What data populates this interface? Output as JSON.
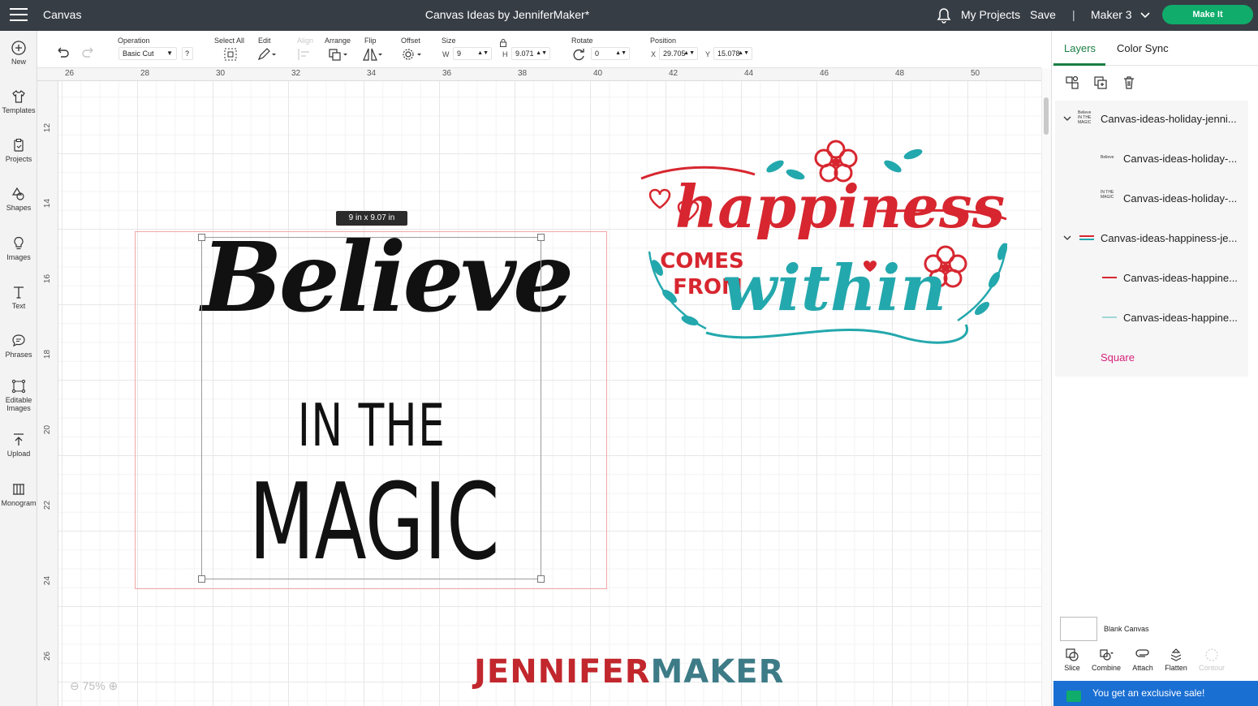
{
  "topbar": {
    "app_title": "Canvas",
    "doc_title": "Canvas Ideas by JenniferMaker*",
    "my_projects": "My Projects",
    "save": "Save",
    "divider": "|",
    "machine": "Maker 3",
    "make_it": "Make It"
  },
  "sidebar": {
    "items": [
      {
        "label": "New",
        "icon": "plus-circle-icon"
      },
      {
        "label": "Templates",
        "icon": "shirt-icon"
      },
      {
        "label": "Projects",
        "icon": "projects-icon"
      },
      {
        "label": "Shapes",
        "icon": "shapes-icon"
      },
      {
        "label": "Images",
        "icon": "lightbulb-icon"
      },
      {
        "label": "Text",
        "icon": "text-icon"
      },
      {
        "label": "Phrases",
        "icon": "speech-bubble-icon"
      },
      {
        "label": "Editable Images",
        "icon": "editable-images-icon"
      },
      {
        "label": "Upload",
        "icon": "upload-icon"
      },
      {
        "label": "Monogram",
        "icon": "monogram-icon"
      }
    ]
  },
  "toolbar": {
    "operation_label": "Operation",
    "operation_value": "Basic Cut",
    "help": "?",
    "select_all_label": "Select All",
    "edit_label": "Edit",
    "align_label": "Align",
    "arrange_label": "Arrange",
    "flip_label": "Flip",
    "offset_label": "Offset",
    "size_label": "Size",
    "w_label": "W",
    "w_value": "9",
    "h_label": "H",
    "h_value": "9.071",
    "rotate_label": "Rotate",
    "rotate_value": "0",
    "position_label": "Position",
    "x_label": "X",
    "x_value": "29.705",
    "y_label": "Y",
    "y_value": "15.078"
  },
  "ruler": {
    "horizontal": [
      "26",
      "28",
      "30",
      "32",
      "34",
      "36",
      "38",
      "40",
      "42",
      "44",
      "46",
      "48",
      "50"
    ],
    "vertical": [
      "12",
      "14",
      "16",
      "18",
      "20",
      "22",
      "24",
      "26"
    ]
  },
  "canvas": {
    "size_tag": "9  in x 9.07  in",
    "believe_text": "Believe",
    "inthe_text": "IN THE",
    "magic_text": "MAGIC",
    "art_line1": "happiness",
    "art_comes": "COMES",
    "art_from": "FROM",
    "art_within": "within",
    "zoom": "75%",
    "brand_part1": "JENNIFER",
    "brand_part2": "MAKER"
  },
  "layers_panel": {
    "tab_layers": "Layers",
    "tab_color_sync": "Color Sync",
    "layers": [
      {
        "name": "Canvas-ideas-holiday-jenni...",
        "level": 0,
        "expanded": true,
        "thumb": "Believe IN THE MAGIC"
      },
      {
        "name": "Canvas-ideas-holiday-...",
        "level": 1,
        "thumb": "Believe"
      },
      {
        "name": "Canvas-ideas-holiday-...",
        "level": 1,
        "thumb": "IN THE MAGIC"
      },
      {
        "name": "Canvas-ideas-happiness-je...",
        "level": 0,
        "expanded": true,
        "thumb": ""
      },
      {
        "name": "Canvas-ideas-happine...",
        "level": 1,
        "thumb": ""
      },
      {
        "name": "Canvas-ideas-happine...",
        "level": 1,
        "thumb": ""
      },
      {
        "name": "Square",
        "level": 0,
        "thumb": ""
      }
    ],
    "blank_canvas": "Blank Canvas",
    "actions": [
      {
        "label": "Slice",
        "enabled": true
      },
      {
        "label": "Combine",
        "enabled": true
      },
      {
        "label": "Attach",
        "enabled": true
      },
      {
        "label": "Flatten",
        "enabled": true
      },
      {
        "label": "Contour",
        "enabled": false
      }
    ],
    "sale_banner": "You get an exclusive sale!"
  },
  "colors": {
    "topbar_bg": "#373d45",
    "make_it_green": "#0fac6b",
    "active_tab_green": "#1a7f45",
    "square_layer_pink": "#d4237a",
    "art_red": "#d7262f",
    "art_teal": "#23a8ad",
    "brand_red": "#c1272d",
    "brand_teal": "#3d7b87",
    "sale_blue": "#1a6fd3"
  }
}
